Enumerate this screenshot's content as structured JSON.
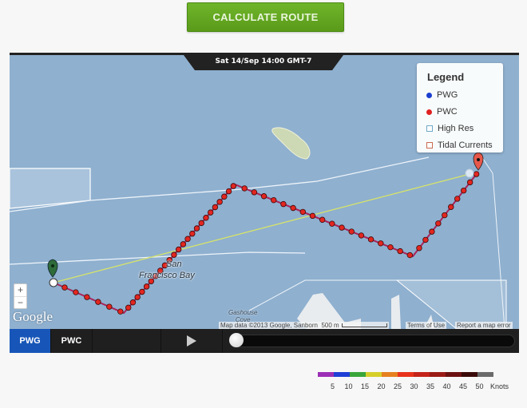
{
  "calculate_button": "CALCULATE ROUTE",
  "timestamp": "Sat 14/Sep 14:00 GMT-7",
  "legend": {
    "title": "Legend",
    "items": [
      {
        "label": "PWG",
        "type": "dot",
        "color": "#1a3fd0"
      },
      {
        "label": "PWC",
        "type": "dot",
        "color": "#e02020"
      },
      {
        "label": "High Res",
        "type": "square",
        "color": "#6fa8c8"
      },
      {
        "label": "Tidal Currents",
        "type": "square",
        "color": "#c86a50"
      }
    ]
  },
  "map": {
    "place_label": "San Francisco Bay",
    "place_label_line1": "San",
    "place_label_line2": "Francisco Bay",
    "gashouse_line1": "Gashouse",
    "gashouse_line2": "Cove",
    "google_logo": "Google",
    "attribution": "Map data ©2013 Google, Sanborn",
    "scale": "500 m",
    "terms": "Terms of Use",
    "report": "Report a map error",
    "zoom_in": "+",
    "zoom_out": "−"
  },
  "controls": {
    "pwg_tab": "PWG",
    "pwc_tab": "PWC",
    "active_tab": "PWG",
    "play_icon": "play",
    "timeline_progress": 0
  },
  "wind_scale": {
    "unit": "Knots",
    "labels": [
      "5",
      "10",
      "15",
      "20",
      "25",
      "30",
      "35",
      "40",
      "45",
      "50"
    ],
    "colors": [
      "#9b2fb5",
      "#1f3fd6",
      "#3aa63a",
      "#d6cf2a",
      "#e6801f",
      "#e8321c",
      "#c4241a",
      "#9a1b16",
      "#6b1210",
      "#3a0a08",
      "#6a6a6a"
    ]
  }
}
